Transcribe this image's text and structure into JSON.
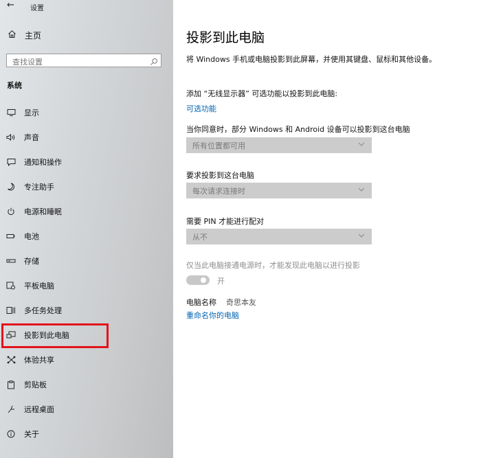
{
  "window": {
    "back_glyph": "←",
    "title": "设置"
  },
  "sidebar": {
    "home": {
      "label": "主页"
    },
    "search": {
      "placeholder": "查找设置"
    },
    "section_label": "系统",
    "items": [
      {
        "label": "显示",
        "icon": "monitor-icon"
      },
      {
        "label": "声音",
        "icon": "speaker-icon"
      },
      {
        "label": "通知和操作",
        "icon": "notification-icon"
      },
      {
        "label": "专注助手",
        "icon": "moon-icon"
      },
      {
        "label": "电源和睡眠",
        "icon": "power-icon"
      },
      {
        "label": "电池",
        "icon": "battery-icon"
      },
      {
        "label": "存储",
        "icon": "storage-icon"
      },
      {
        "label": "平板电脑",
        "icon": "tablet-icon"
      },
      {
        "label": "多任务处理",
        "icon": "multitask-icon"
      },
      {
        "label": "投影到此电脑",
        "icon": "project-icon",
        "selected": true
      },
      {
        "label": "体验共享",
        "icon": "share-icon"
      },
      {
        "label": "剪贴板",
        "icon": "clipboard-icon"
      },
      {
        "label": "远程桌面",
        "icon": "remote-desktop-icon"
      },
      {
        "label": "关于",
        "icon": "info-icon"
      }
    ]
  },
  "main": {
    "title": "投影到此电脑",
    "intro": "将 Windows 手机或电脑投影到此屏幕，并使用其键盘、鼠标和其他设备。",
    "add_display_text": "添加 “无线显示器” 可选功能以投影到此电脑:",
    "optional_features_link": "可选功能",
    "when_agree_label": "当你同意时，部分 Windows 和 Android 设备可以投影到这台电脑",
    "when_agree_value": "所有位置都可用",
    "require_label": "要求投影到这台电脑",
    "require_value": "每次请求连接时",
    "pin_label": "需要 PIN 才能进行配对",
    "pin_value": "从不",
    "power_only_label": "仅当此电脑接通电源时，才能发现此电脑以进行投影",
    "toggle_label": "开",
    "toggle_on": true,
    "pc_name_label": "电脑名称",
    "pc_name_value": "奇思本友",
    "rename_link": "重命名你的电脑"
  },
  "colors": {
    "accent_link": "#0063b1",
    "highlight_box": "#e3131b",
    "dropdown_bg": "#cccccc"
  }
}
